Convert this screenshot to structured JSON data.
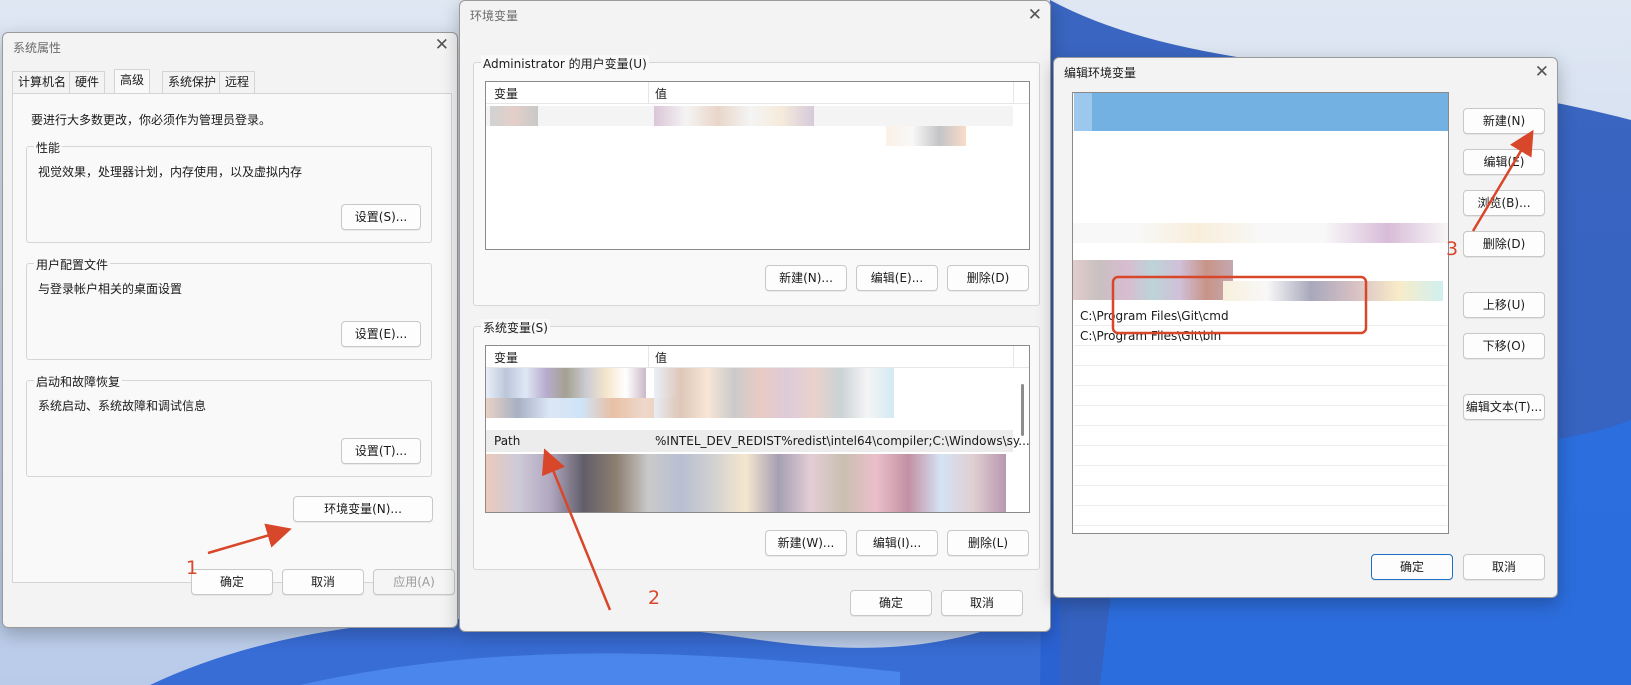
{
  "colors": {
    "accent": "#d9472b",
    "selection": "#74b1e3",
    "primary_border": "#1f6fc4"
  },
  "sysprops": {
    "title": "系统属性",
    "close_glyph": "✕",
    "tabs": [
      "计算机名",
      "硬件",
      "高级",
      "系统保护",
      "远程"
    ],
    "active_tab": "高级",
    "admin_note": "要进行大多数更改，你必须作为管理员登录。",
    "perf": {
      "label": "性能",
      "desc": "视觉效果，处理器计划，内存使用，以及虚拟内存",
      "button": "设置(S)..."
    },
    "profile": {
      "label": "用户配置文件",
      "desc": "与登录帐户相关的桌面设置",
      "button": "设置(E)..."
    },
    "startup": {
      "label": "启动和故障恢复",
      "desc": "系统启动、系统故障和调试信息",
      "button": "设置(T)..."
    },
    "env_button": "环境变量(N)...",
    "ok": "确定",
    "cancel": "取消",
    "apply": "应用(A)"
  },
  "envvars": {
    "title": "环境变量",
    "close_glyph": "✕",
    "user_group_label": "Administrator 的用户变量(U)",
    "col_var": "变量",
    "col_val": "值",
    "user_new": "新建(N)...",
    "user_edit": "编辑(E)...",
    "user_delete": "删除(D)",
    "sys_group_label": "系统变量(S)",
    "path_row": {
      "name": "Path",
      "value": "%INTEL_DEV_REDIST%redist\\intel64\\compiler;C:\\Windows\\sy..."
    },
    "sys_new": "新建(W)...",
    "sys_edit": "编辑(I)...",
    "sys_delete": "删除(L)",
    "ok": "确定",
    "cancel": "取消"
  },
  "editenv": {
    "title": "编辑环境变量",
    "close_glyph": "✕",
    "entries": [
      "C:\\Program Files\\Git\\cmd",
      "C:\\Program Files\\Git\\bin"
    ],
    "buttons": {
      "new": "新建(N)",
      "edit": "编辑(E)",
      "browse": "浏览(B)...",
      "delete": "删除(D)",
      "up": "上移(U)",
      "down": "下移(O)",
      "edit_text": "编辑文本(T)..."
    },
    "ok": "确定",
    "cancel": "取消"
  },
  "annotations": {
    "step1": "1",
    "step2": "2",
    "step3": "3"
  }
}
